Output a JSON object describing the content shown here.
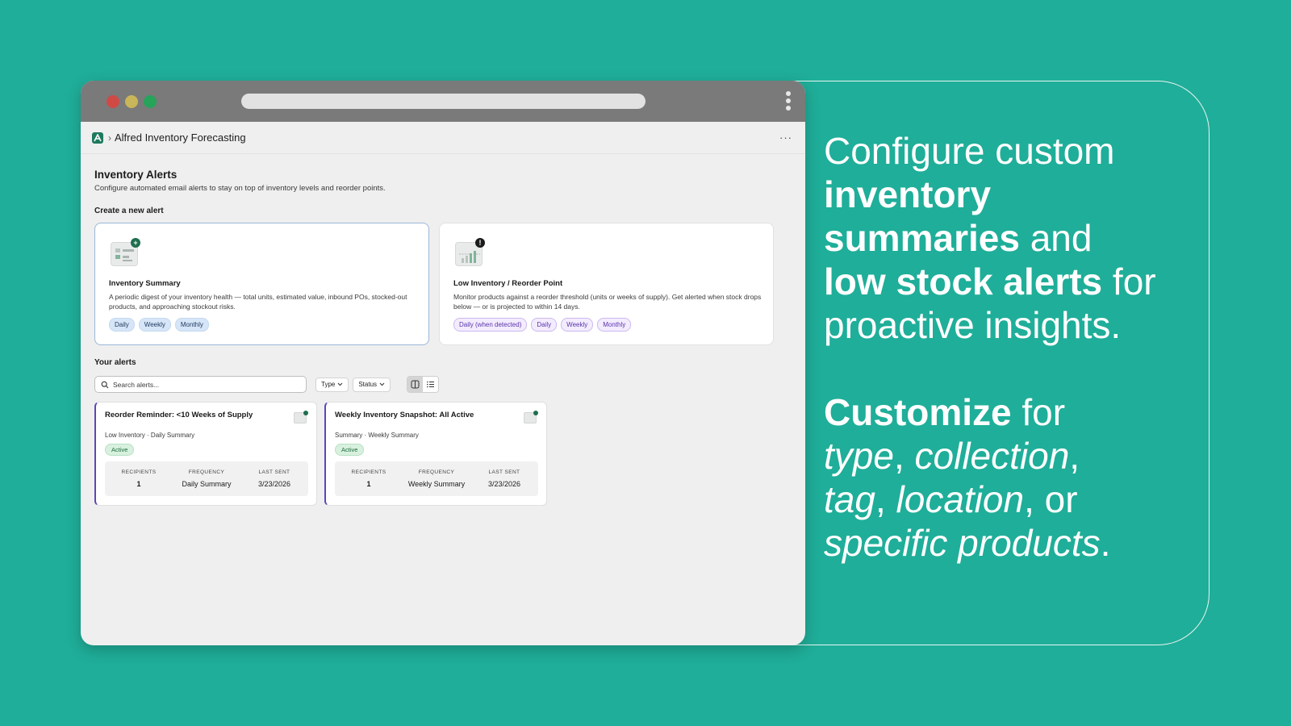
{
  "app": {
    "title": "Alfred Inventory Forecasting",
    "breadcrumb_sep": "›",
    "more": "···"
  },
  "page": {
    "title": "Inventory Alerts",
    "subtitle": "Configure automated email alerts to stay on top of inventory levels and reorder points.",
    "create_label": "Create a new alert",
    "alerts_label": "Your alerts"
  },
  "create_cards": [
    {
      "title": "Inventory Summary",
      "description": "A periodic digest of your inventory health — total units, estimated value, inbound POs, stocked-out products, and approaching stockout risks.",
      "badge": "+",
      "tags": [
        "Daily",
        "Weekly",
        "Monthly"
      ]
    },
    {
      "title": "Low Inventory / Reorder Point",
      "description": "Monitor products against a reorder threshold (units or weeks of supply). Get alerted when stock drops below — or is projected to within 14 days.",
      "badge": "!",
      "tags": [
        "Daily (when detected)",
        "Daily",
        "Weekly",
        "Monthly"
      ]
    }
  ],
  "toolbar": {
    "search_placeholder": "Search alerts...",
    "type_label": "Type",
    "status_label": "Status"
  },
  "alerts": [
    {
      "title": "Reorder Reminder: <10 Weeks of Supply",
      "meta": "Low Inventory · Daily Summary",
      "status": "Active",
      "recipients_label": "RECIPIENTS",
      "recipients": "1",
      "frequency_label": "FREQUENCY",
      "frequency": "Daily Summary",
      "last_sent_label": "LAST SENT",
      "last_sent": "3/23/2026"
    },
    {
      "title": "Weekly Inventory Snapshot: All Active",
      "meta": "Summary · Weekly Summary",
      "status": "Active",
      "recipients_label": "RECIPIENTS",
      "recipients": "1",
      "frequency_label": "FREQUENCY",
      "frequency": "Weekly Summary",
      "last_sent_label": "LAST SENT",
      "last_sent": "3/23/2026"
    }
  ],
  "marketing": {
    "l1": "Configure custom",
    "l2_bold": "inventory",
    "l3_bold": "summaries",
    "l3_rest": " and",
    "l4_bold": "low stock alerts",
    "l4_rest": " for",
    "l5": "proactive insights.",
    "l6_bold": "Customize",
    "l6_rest": " for",
    "l7_i1": "type",
    "l7_sep": ", ",
    "l7_i2": "collection",
    "l7_end": ",",
    "l8_i1": "tag",
    "l8_sep": ", ",
    "l8_i2": "location",
    "l8_end": ", or",
    "l9_i": "specific products",
    "l9_end": "."
  },
  "colors": {
    "background": "#1fae99",
    "accent_border": "#5b46b8",
    "brand": "#1e7a5e"
  }
}
